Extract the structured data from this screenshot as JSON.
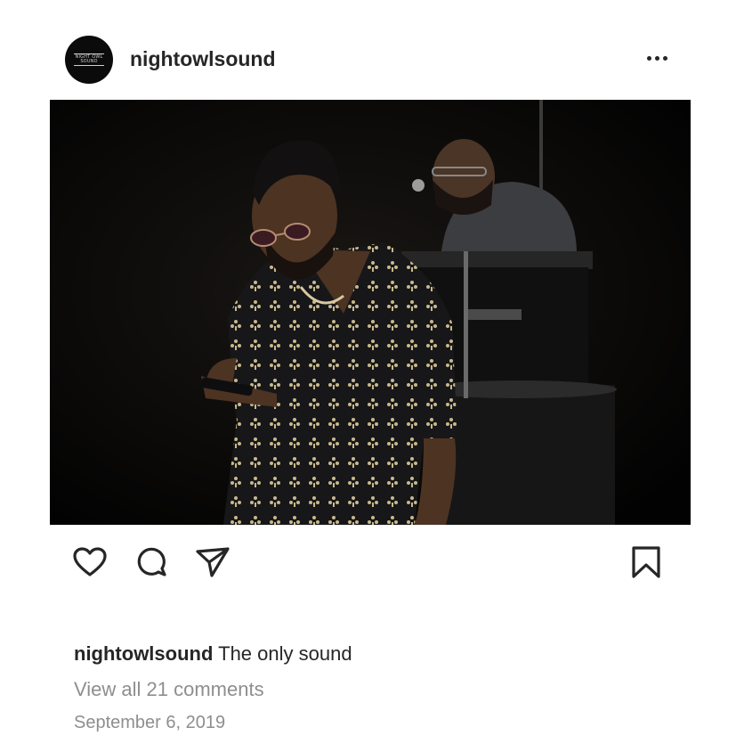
{
  "post": {
    "username": "nightowlsound",
    "avatar_text": "NIGHT OWL SOUND",
    "more_icon": "more-horizontal-icon",
    "photo_description": "",
    "actions": {
      "like_icon": "heart-icon",
      "comment_icon": "comment-icon",
      "share_icon": "send-icon",
      "save_icon": "bookmark-icon"
    },
    "caption": {
      "username": "nightowlsound",
      "text": "The only sound"
    },
    "view_comments": "View all 21 comments",
    "date": "September 6, 2019"
  },
  "colors": {
    "text": "#262626",
    "secondary_text": "#8e8e8e",
    "background": "#ffffff",
    "photo_background": "#040404"
  }
}
